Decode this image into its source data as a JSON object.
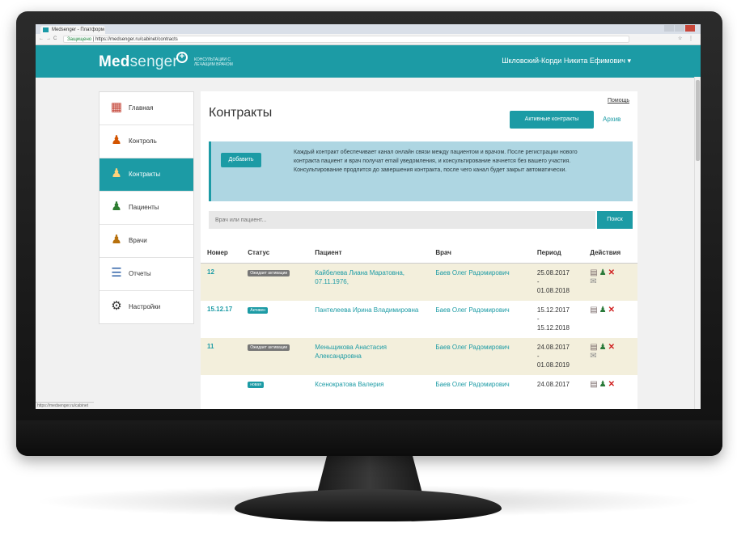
{
  "browser": {
    "tab_title": "Medsenger - Платформ",
    "url_secure": "Защищено",
    "url": "https://medsenger.ru/cabinet/contracts"
  },
  "header": {
    "logo_bold": "Med",
    "logo_rest": "senger",
    "logo_subtitle": "КОНСУЛЬТАЦИИ С ЛЕЧАЩИМ ВРАЧОМ",
    "user": "Шкловский-Корди Никита Ефимович ▾"
  },
  "sidebar": {
    "items": [
      {
        "label": "Главная",
        "icon": "home-icon",
        "glyph": "▦",
        "color": "#c0392b"
      },
      {
        "label": "Контроль",
        "icon": "control-icon",
        "glyph": "♟",
        "color": "#d35400"
      },
      {
        "label": "Контракты",
        "icon": "contracts-icon",
        "glyph": "♟",
        "color": "#ffffff"
      },
      {
        "label": "Пациенты",
        "icon": "patients-icon",
        "glyph": "♟",
        "color": "#2e7d32"
      },
      {
        "label": "Врачи",
        "icon": "doctors-icon",
        "glyph": "♟",
        "color": "#b7700c"
      },
      {
        "label": "Отчеты",
        "icon": "reports-icon",
        "glyph": "☰",
        "color": "#2b5fa6"
      },
      {
        "label": "Настройки",
        "icon": "settings-icon",
        "glyph": "⚙",
        "color": "#333333"
      }
    ]
  },
  "main": {
    "title": "Контракты",
    "help": "Помощь",
    "active_button": "Активные контракты",
    "archive": "Архив",
    "add_button": "Добавить",
    "info_text": "Каждый контракт обеспечивает канал онлайн связи между пациентом и врачом. После регистрации нового контракта пациент и врач получат email уведомления, и консультирование начнется без вашего участия. Консультирование продлится до завершения контракта, после чего канал будет закрыт автоматически.",
    "search_placeholder": "Врач или пациент...",
    "search_button": "Поиск"
  },
  "table": {
    "headers": [
      "Номер",
      "Статус",
      "Пациент",
      "Врач",
      "Период",
      "Действия"
    ],
    "rows": [
      {
        "number": "12",
        "status": "Ожидает активации",
        "status_type": "wait",
        "patient": "Кайбелева Лиана Маратовна, 07.11.1976,",
        "doctor": "Баев Олег Радомирович",
        "period_start": "25.08.2017",
        "period_sep": "-",
        "period_end": "01.08.2018"
      },
      {
        "number": "15.12.17",
        "status": "Активен",
        "status_type": "active",
        "patient": "Пантелеева Ирина Владимировна",
        "doctor": "Баев Олег Радомирович",
        "period_start": "15.12.2017",
        "period_sep": "-",
        "period_end": "15.12.2018"
      },
      {
        "number": "11",
        "status": "Ожидает активации",
        "status_type": "wait",
        "patient": "Меньщикова Анастасия Александровна",
        "doctor": "Баев Олег Радомирович",
        "period_start": "24.08.2017",
        "period_sep": "-",
        "period_end": "01.08.2019"
      },
      {
        "number": "",
        "status": "новая",
        "status_type": "active",
        "patient": "Ксенократова Валерия",
        "doctor": "Баев Олег Радомирович",
        "period_start": "24.08.2017",
        "period_sep": "",
        "period_end": ""
      }
    ]
  },
  "statusbar": "https://medsenger.ru/cabinet"
}
